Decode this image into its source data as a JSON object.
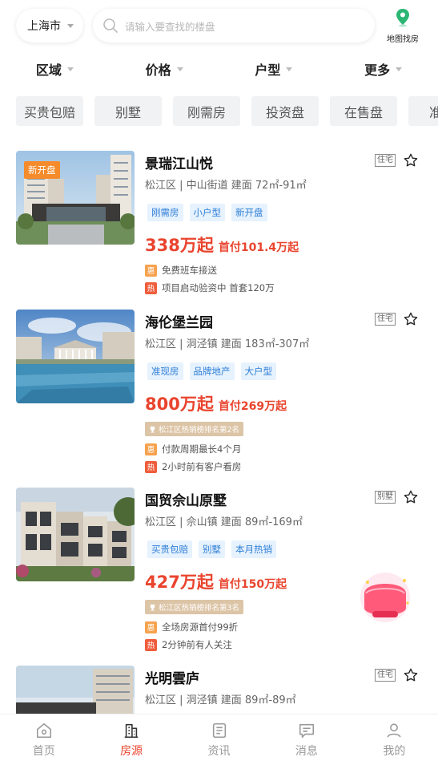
{
  "header": {
    "city": "上海市",
    "search_placeholder": "请输入要查找的楼盘",
    "map_label": "地图找房"
  },
  "filters": [
    "区域",
    "价格",
    "户型",
    "更多"
  ],
  "tags": [
    "买贵包赔",
    "别墅",
    "刚需房",
    "投资盘",
    "在售盘",
    "准现"
  ],
  "listings": [
    {
      "name": "景瑞江山悦",
      "type": "住宅",
      "meta": "松江区 | 中山街道 建面 72㎡-91㎡",
      "chips": [
        "刚需房",
        "小户型",
        "新开盘"
      ],
      "price": "338万起",
      "down": "首付101.4万起",
      "badge": "新开盘",
      "perks": [
        {
          "icon": "惠",
          "text": "免费班车接送"
        },
        {
          "icon": "热",
          "text": "项目启动验资中 首套120万"
        }
      ]
    },
    {
      "name": "海伦堡兰园",
      "type": "住宅",
      "meta": "松江区 | 洞泾镇 建面 183㎡-307㎡",
      "chips": [
        "准现房",
        "品牌地产",
        "大户型"
      ],
      "price": "800万起",
      "down": "首付269万起",
      "rank": "松江区热销榜排名第2名",
      "perks": [
        {
          "icon": "惠",
          "text": "付款周期最长4个月"
        },
        {
          "icon": "热",
          "text": "2小时前有客户看房"
        }
      ]
    },
    {
      "name": "国贸佘山原墅",
      "type": "别墅",
      "meta": "松江区 | 佘山镇 建面 89㎡-169㎡",
      "chips": [
        "买贵包赔",
        "别墅",
        "本月热销"
      ],
      "price": "427万起",
      "down": "首付150万起",
      "rank": "松江区热销榜排名第3名",
      "perks": [
        {
          "icon": "惠",
          "text": "全场房源首付99折"
        },
        {
          "icon": "热",
          "text": "2分钟前有人关注"
        }
      ]
    },
    {
      "name": "光明雲庐",
      "type": "住宅",
      "meta": "松江区 | 洞泾镇 建面 89㎡-89㎡"
    }
  ],
  "nav": [
    "首页",
    "房源",
    "资讯",
    "消息",
    "我的"
  ],
  "colors": {
    "accent": "#e9442e",
    "chip_text": "#2f7fd7",
    "map_icon": "#2bb673"
  }
}
